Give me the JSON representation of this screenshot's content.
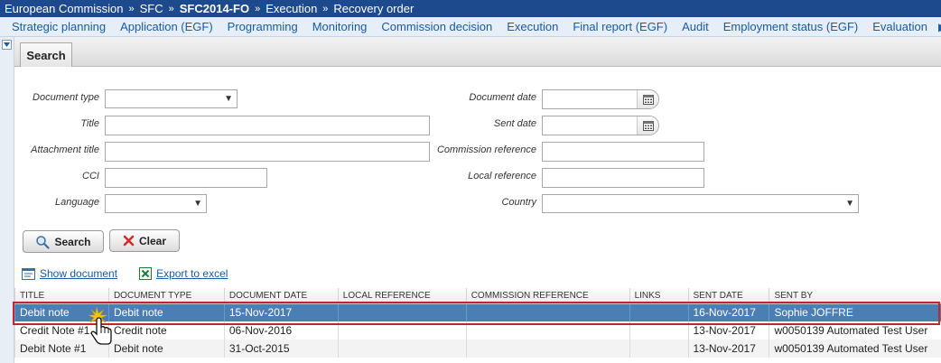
{
  "breadcrumb": [
    "European Commission",
    "SFC",
    "SFC2014-FO",
    "Execution",
    "Recovery order"
  ],
  "breadcrumb_separator": "»",
  "menu": [
    "Strategic planning",
    "Application (EGF)",
    "Programming",
    "Monitoring",
    "Commission decision",
    "Execution",
    "Final report (EGF)",
    "Audit",
    "Employment status (EGF)",
    "Evaluation"
  ],
  "menu_more": "▶",
  "tab": "Search",
  "form": {
    "document_type": "Document type",
    "title": "Title",
    "attachment_title": "Attachment title",
    "cci": "CCI",
    "language": "Language",
    "document_date": "Document date",
    "sent_date": "Sent date",
    "commission_reference": "Commission reference",
    "local_reference": "Local reference",
    "country": "Country"
  },
  "buttons": {
    "search": "Search",
    "clear": "Clear"
  },
  "links": {
    "show_document": "Show document",
    "export_to_excel": "Export to excel"
  },
  "table": {
    "headers": [
      "TITLE",
      "DOCUMENT TYPE",
      "DOCUMENT DATE",
      "LOCAL REFERENCE",
      "COMMISSION REFERENCE",
      "LINKS",
      "SENT DATE",
      "SENT BY"
    ],
    "rows": [
      [
        "Debit note",
        "Debit note",
        "15-Nov-2017",
        "",
        "",
        "",
        "16-Nov-2017",
        "Sophie JOFFRE"
      ],
      [
        "Credit Note #1",
        "Credit note",
        "06-Nov-2016",
        "",
        "",
        "",
        "13-Nov-2017",
        "w0050139 Automated Test User"
      ],
      [
        "Debit Note #1",
        "Debit note",
        "31-Oct-2015",
        "",
        "",
        "",
        "13-Nov-2017",
        "w0050139 Automated Test User"
      ]
    ]
  },
  "colors": {
    "breadcrumb_bg": "#1d4a8c",
    "menu_link": "#1a5aa6",
    "selected_row": "#4a7fb5",
    "selection_outline": "#c0262d"
  }
}
